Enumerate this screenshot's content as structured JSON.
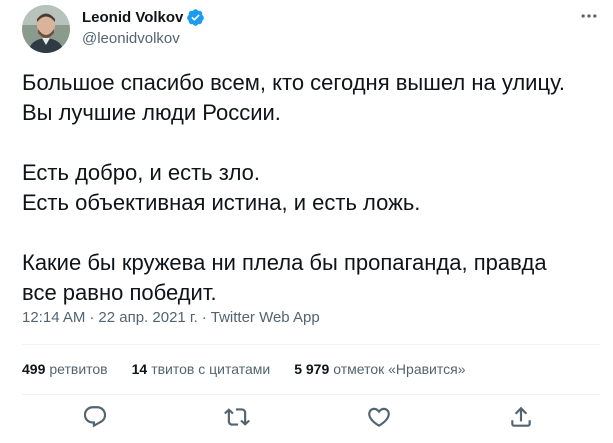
{
  "author": {
    "display_name": "Leonid Volkov",
    "handle": "@leonidvolkov",
    "verified_icon": "verified-badge-icon",
    "accent_color": "#1d9bf0"
  },
  "more_icon": "more-horizontal-icon",
  "tweet": {
    "lines": [
      "Большое спасибо всем, кто сегодня вышел на улицу.",
      "Вы лучшие люди России.",
      "Есть добро, и есть зло.",
      "Есть объективная истина, и есть ложь.",
      "Какие бы кружева ни плела бы пропаганда, правда",
      "все равно победит."
    ]
  },
  "meta": {
    "time": "12:14 AM",
    "separator": "·",
    "date": "22 апр. 2021 г.",
    "source": "Twitter Web App"
  },
  "stats": {
    "retweets_count": "499",
    "retweets_label": "ретвитов",
    "quotes_count": "14",
    "quotes_label": "твитов с цитатами",
    "likes_count": "5 979",
    "likes_label": "отметок «Нравится»"
  },
  "actions": [
    "reply-icon",
    "retweet-icon",
    "like-icon",
    "share-icon"
  ],
  "colors": {
    "text": "#0f1419",
    "secondary": "#536471",
    "divider": "#eff3f4"
  }
}
